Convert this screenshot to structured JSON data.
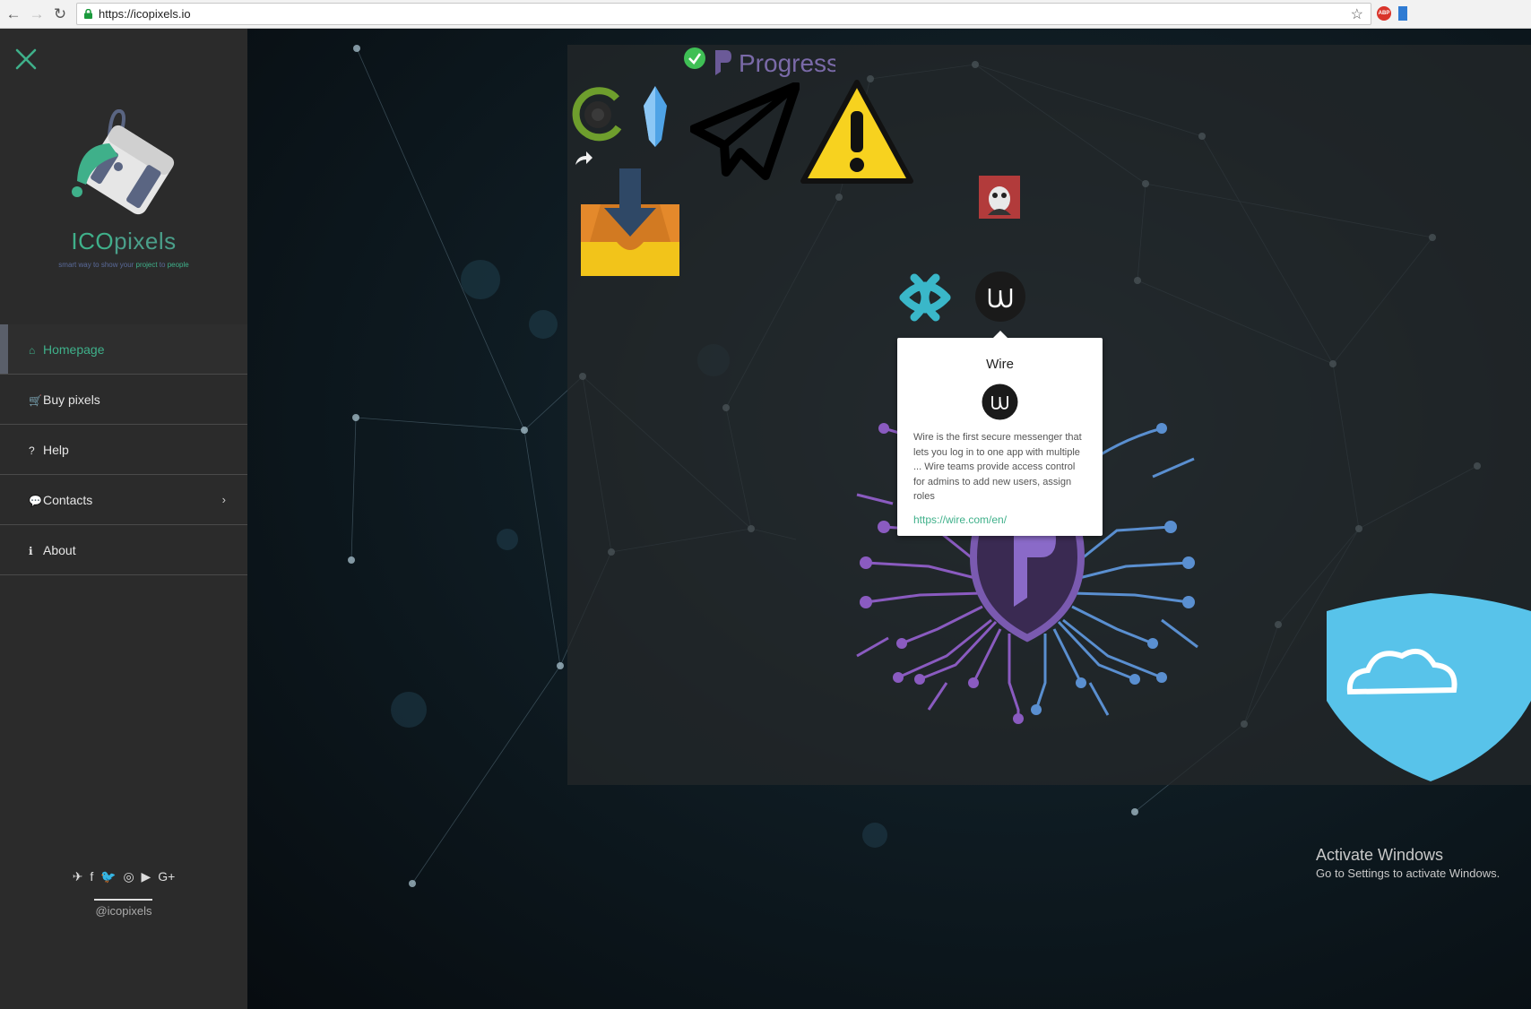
{
  "browser": {
    "url": "https://icopixels.io",
    "back_icon": "←",
    "forward_icon": "→",
    "reload_icon": "↻",
    "star_icon": "☆",
    "adblock_label": "ABP"
  },
  "sidebar": {
    "brand_ico": "ICO",
    "brand_pixels": "pixels",
    "tagline": {
      "part1": "smart way",
      "part2": " to show your ",
      "part3": "project",
      "part4": " to ",
      "part5": "people"
    },
    "menu": [
      {
        "icon": "⌂",
        "label": "Homepage"
      },
      {
        "icon": "🛒",
        "label": "Buy pixels"
      },
      {
        "icon": "?",
        "label": "Help"
      },
      {
        "icon": "💬",
        "label": "Contacts"
      },
      {
        "icon": "ℹ",
        "label": "About"
      }
    ],
    "contacts_chevron": "›",
    "socials": [
      "telegram-icon",
      "facebook-icon",
      "twitter-icon",
      "instagram-icon",
      "youtube-icon",
      "google-plus-icon"
    ],
    "social_glyphs": [
      "✈",
      "f",
      "🐦",
      "◎",
      "▶",
      "G+"
    ],
    "handle": "@icopixels"
  },
  "pixel_board": {
    "progress_label": "Progress",
    "tooltip": {
      "title": "Wire",
      "description": "Wire is the first secure messenger that lets you log in to one app with multiple ... Wire teams provide access control for admins to add new users, assign roles",
      "link": "https://wire.com/en/"
    }
  },
  "watermark": {
    "title": "Activate Windows",
    "subtitle": "Go to Settings to activate Windows."
  },
  "colors": {
    "accent": "#3fb08a",
    "sidebar_bg": "#2b2b2b",
    "warning_yellow": "#f7d21f",
    "inbox_orange": "#e4892b",
    "shield_blue": "#58c3ea"
  }
}
